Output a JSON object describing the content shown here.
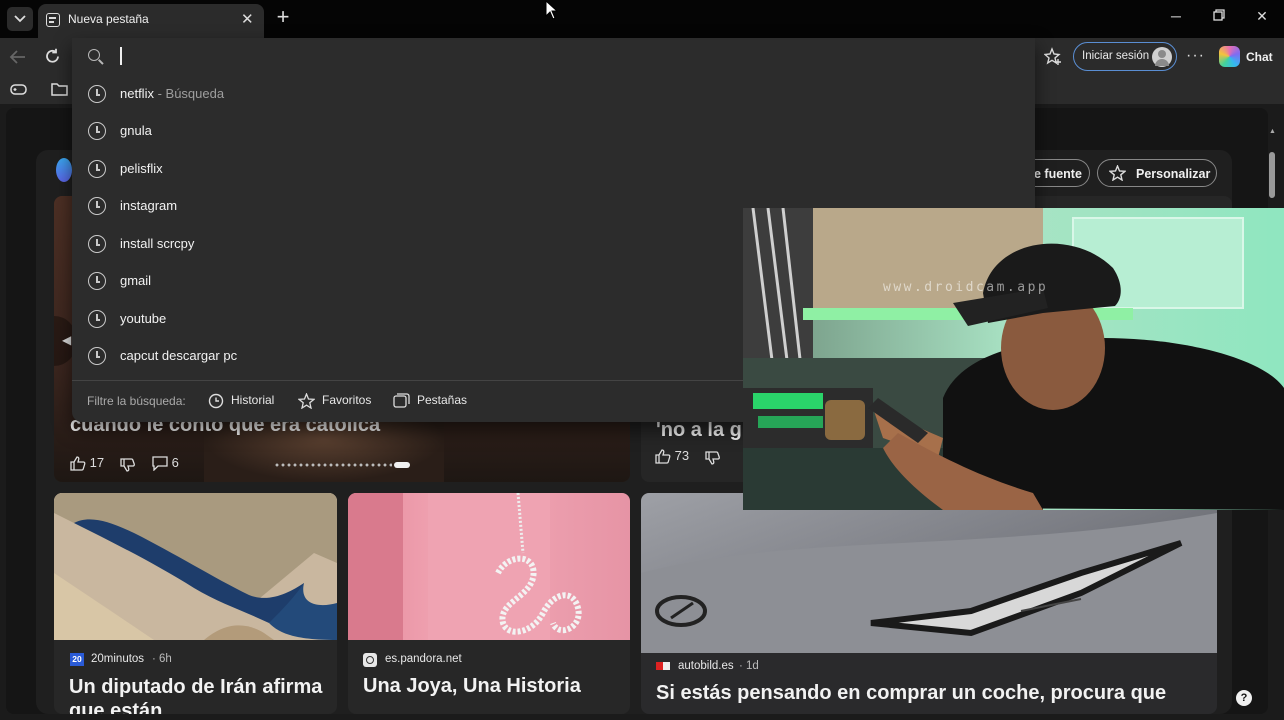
{
  "tab": {
    "title": "Nueva pestaña"
  },
  "toolbar": {
    "signin_label": "Iniciar sesión",
    "chat_label": "Chat"
  },
  "omnibox": {
    "value": "",
    "suggestions": [
      {
        "text": "netflix",
        "sub": " - Búsqueda"
      },
      {
        "text": "gnula",
        "sub": ""
      },
      {
        "text": "pelisflix",
        "sub": ""
      },
      {
        "text": "instagram",
        "sub": ""
      },
      {
        "text": "install scrcpy",
        "sub": ""
      },
      {
        "text": "gmail",
        "sub": ""
      },
      {
        "text": "youtube",
        "sub": ""
      },
      {
        "text": "capcut descargar pc",
        "sub": ""
      }
    ],
    "filter_label": "Filtre la búsqueda:",
    "filters": [
      "Historial",
      "Favoritos",
      "Pestañas"
    ]
  },
  "feed": {
    "source_btn": "e fuente",
    "personalize_btn": "Personalizar",
    "hero": {
      "headline": "cuando le contó que era católica",
      "likes": "17",
      "comments": "6"
    },
    "hero2": {
      "headline": "'no a la g",
      "likes": "73"
    },
    "cards": [
      {
        "source": "20minutos",
        "meta": "· 6h",
        "badge": "20",
        "headline": "Un diputado de Irán afirma que están"
      },
      {
        "source": "es.pandora.net",
        "meta": "",
        "badge": "",
        "headline": "Una Joya, Una Historia"
      },
      {
        "source": "autobild.es",
        "meta": "· 1d",
        "badge": "",
        "headline": "Si estás pensando en comprar un coche, procura que"
      }
    ],
    "help": "?"
  },
  "webcam": {
    "watermark": "www.droidcam.app"
  },
  "colors": {
    "accent": "#4f8bd6",
    "bg": "#1b1b1b"
  }
}
